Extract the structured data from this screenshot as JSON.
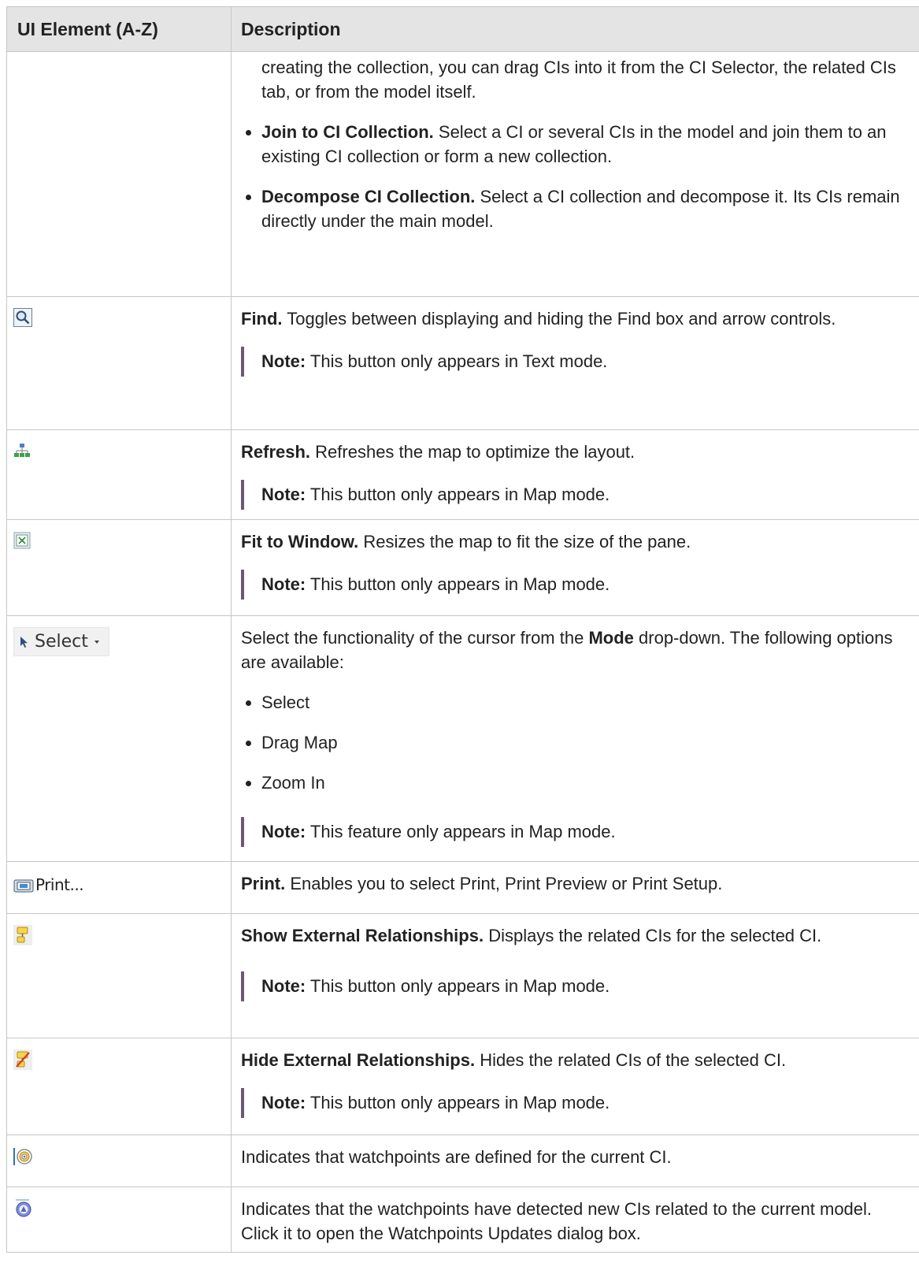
{
  "header": {
    "col1": "UI Element (A-Z)",
    "col2": "Description"
  },
  "rows": [
    {
      "continuation": "creating the collection, you can drag CIs into it from the CI Selector, the related CIs tab, or from the model itself.",
      "bullets": [
        {
          "bold": "Join to CI Collection.",
          "text": " Select a CI or several CIs in the model and join them to an existing CI collection or form a new collection."
        },
        {
          "bold": "Decompose CI Collection.",
          "text": " Select a CI collection and decompose it. Its CIs remain directly under the main model."
        }
      ]
    },
    {
      "icon": "find-magnifier-icon",
      "title": "Find.",
      "desc": " Toggles between displaying and hiding the Find box and arrow controls.",
      "note_label": "Note:",
      "note": " This button only appears in Text mode."
    },
    {
      "icon": "refresh-layout-icon",
      "title": "Refresh.",
      "desc": " Refreshes the map to optimize the layout.",
      "note_label": "Note:",
      "note": " This button only appears in Map mode."
    },
    {
      "icon": "fit-to-window-icon",
      "title": "Fit to Window.",
      "desc": " Resizes the map to fit the size of the pane.",
      "note_label": "Note:",
      "note": " This button only appears in Map mode."
    },
    {
      "icon": "cursor-arrow-icon",
      "button_label": "Select",
      "desc_pre": "Select the functionality of the cursor from the ",
      "desc_bold": "Mode",
      "desc_post": " drop-down. The following options are available:",
      "options": [
        "Select",
        "Drag Map",
        "Zoom In"
      ],
      "note_label": "Note:",
      "note": " This feature only appears in Map mode."
    },
    {
      "icon": "printer-icon",
      "button_label": "Print...",
      "title": "Print.",
      "desc": " Enables you to select Print, Print Preview or Print Setup."
    },
    {
      "icon": "show-relationships-icon",
      "title": "Show External Relationships.",
      "desc": " Displays the related CIs for the selected CI.",
      "note_label": "Note:",
      "note": " This button only appears in Map mode."
    },
    {
      "icon": "hide-relationships-icon",
      "title": "Hide External Relationships.",
      "desc": " Hides the related CIs of the selected CI.",
      "note_label": "Note:",
      "note": " This button only appears in Map mode."
    },
    {
      "icon": "watchpoint-target-icon",
      "desc": "Indicates that watchpoints are defined for the current CI."
    },
    {
      "icon": "watchpoint-updates-icon",
      "desc": "Indicates that the watchpoints have detected new CIs related to the current model. Click it to open the Watchpoints Updates dialog box."
    }
  ]
}
